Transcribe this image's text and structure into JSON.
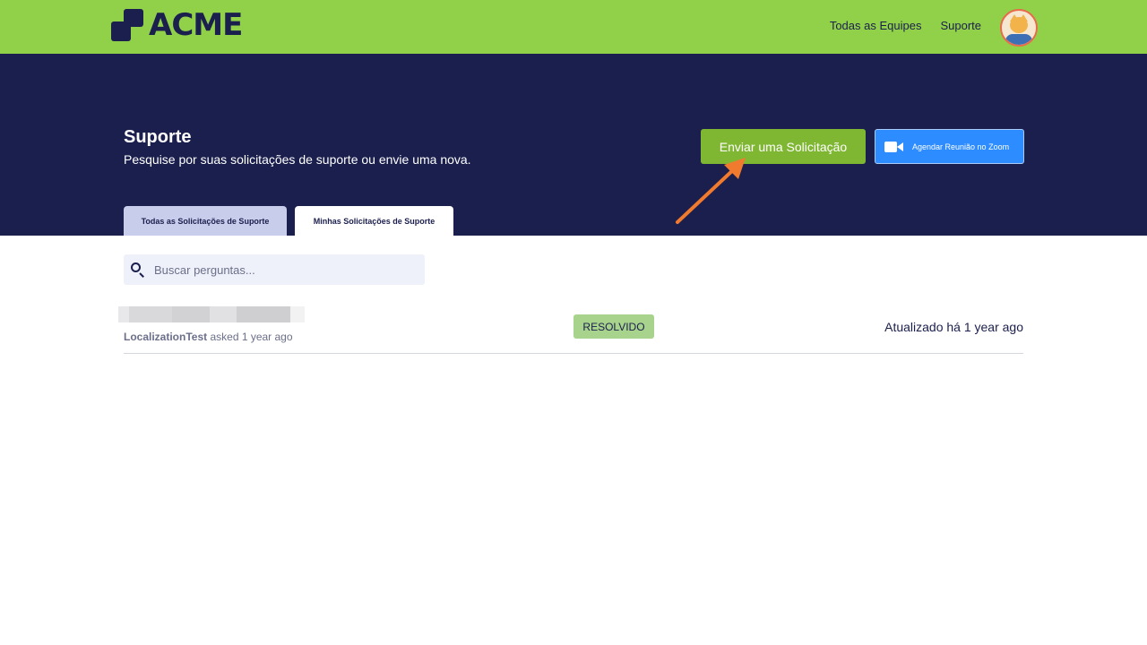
{
  "header": {
    "logo_text": "ACME",
    "nav": [
      "Todas as Equipes",
      "Suporte"
    ],
    "brand_color": "#91d14a"
  },
  "hero": {
    "title": "Suporte",
    "subtitle": "Pesquise por suas solicitações de suporte ou envie uma nova.",
    "submit_button": "Enviar uma Solicitação",
    "zoom_button": "Agendar Reunião no Zoom",
    "tabs": [
      {
        "label": "Todas as Solicitações de Suporte",
        "active": false
      },
      {
        "label": "Minhas Solicitações de Suporte",
        "active": true
      }
    ]
  },
  "search": {
    "placeholder": "Buscar perguntas...",
    "value": ""
  },
  "requests": [
    {
      "author": "LocalizationTest",
      "asked": "asked 1 year ago",
      "status": "RESOLVIDO",
      "updated": "Atualizado há 1 year ago"
    }
  ],
  "colors": {
    "hero_bg": "#1b1f4d",
    "primary_button": "#7fb733",
    "zoom_button": "#2d8cff",
    "status_badge": "#a8d38c",
    "annotation_arrow": "#f07a2e"
  }
}
